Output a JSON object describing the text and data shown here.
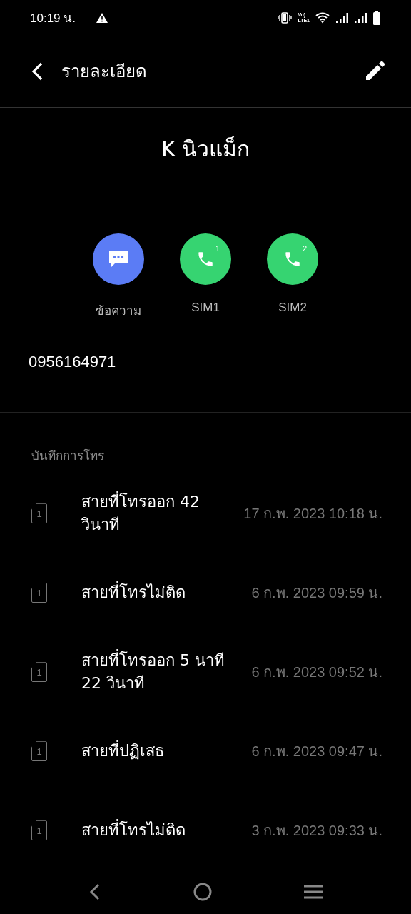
{
  "status_bar": {
    "time": "10:19 น.",
    "volte_top": "Vo)",
    "volte_bottom": "LTE1"
  },
  "header": {
    "title": "รายละเอียด"
  },
  "contact": {
    "name": "K นิวแม็ก",
    "phone": "0956164971"
  },
  "actions": [
    {
      "kind": "message",
      "label": "ข้อความ",
      "color": "#5b7cf5"
    },
    {
      "kind": "call",
      "label": "SIM1",
      "sim": "1",
      "color": "#36d471"
    },
    {
      "kind": "call",
      "label": "SIM2",
      "sim": "2",
      "color": "#36d471"
    }
  ],
  "call_log": {
    "title": "บันทึกการโทร",
    "rows": [
      {
        "sim": "1",
        "description": "สายที่โทรออก 42 วินาที",
        "time": "17 ก.พ. 2023 10:18 น."
      },
      {
        "sim": "1",
        "description": "สายที่โทรไม่ติด",
        "time": "6 ก.พ. 2023 09:59 น."
      },
      {
        "sim": "1",
        "description": "สายที่โทรออก 5 นาที 22 วินาที",
        "time": "6 ก.พ. 2023 09:52 น."
      },
      {
        "sim": "1",
        "description": "สายที่ปฏิเสธ",
        "time": "6 ก.พ. 2023 09:47 น."
      },
      {
        "sim": "1",
        "description": "สายที่โทรไม่ติด",
        "time": "3 ก.พ. 2023 09:33 น."
      }
    ]
  }
}
